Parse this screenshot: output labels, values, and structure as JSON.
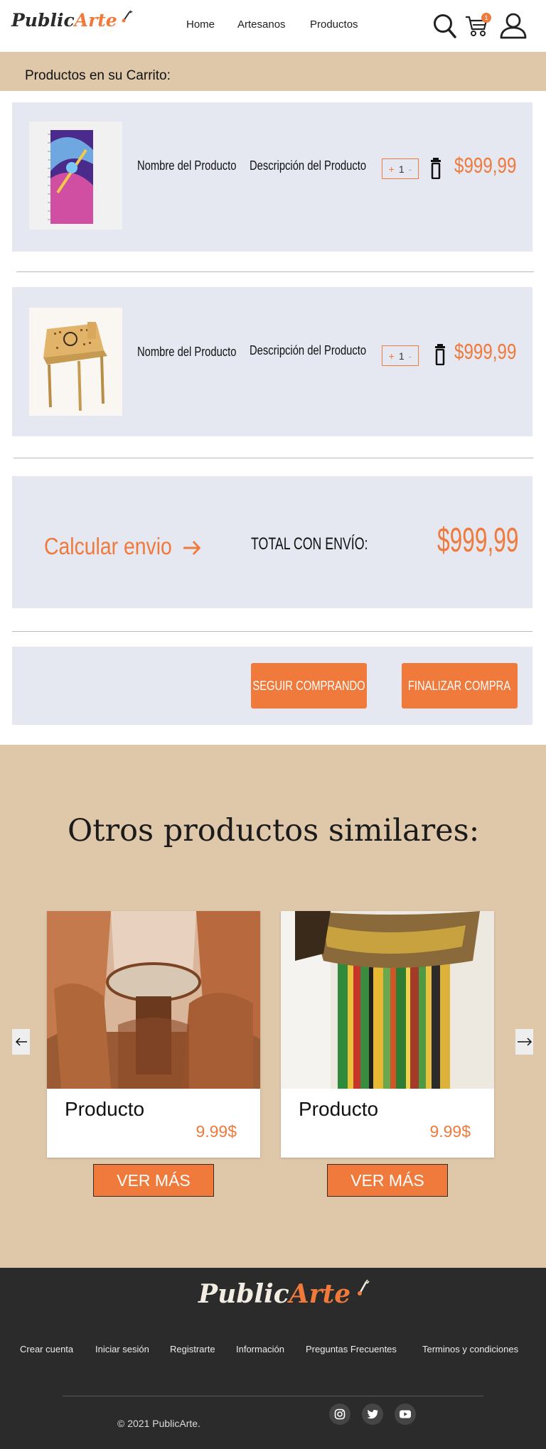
{
  "header": {
    "logo_part1": "Public",
    "logo_part2": "Arte",
    "nav": [
      "Home",
      "Artesanos",
      "Productos"
    ],
    "cart_count": "1"
  },
  "cart": {
    "title": "Productos en su Carrito:",
    "items": [
      {
        "name": "Nombre del Producto",
        "description": "Descripción del Producto",
        "qty_plus": "+",
        "qty": "1",
        "qty_minus": "-",
        "price": "$999,99"
      },
      {
        "name": "Nombre del Producto",
        "description": "Descripción del Producto",
        "qty_plus": "+",
        "qty": "1",
        "qty_minus": "-",
        "price": "$999,99"
      }
    ],
    "shipping_link": "Calcular envio",
    "total_label": "TOTAL CON ENVÍO:",
    "total_price": "$999,99",
    "continue_button": "SEGUIR COMPRANDO",
    "checkout_button": "FINALIZAR COMPRA"
  },
  "similar": {
    "title": "Otros productos similares:",
    "products": [
      {
        "title": "Producto",
        "price": "9.99$",
        "button": "VER MÁS"
      },
      {
        "title": "Producto",
        "price": "9.99$",
        "button": "VER MÁS"
      }
    ]
  },
  "footer": {
    "logo_part1": "Public",
    "logo_part2": "Arte",
    "links": [
      "Crear cuenta",
      "Iniciar sesión",
      "Registrarte",
      "Información",
      "Preguntas Frecuentes",
      "Terminos y condiciones"
    ],
    "copyright": "© 2021 PublicArte.",
    "social": [
      "instagram-icon",
      "twitter-icon",
      "youtube-icon"
    ]
  },
  "colors": {
    "accent": "#ef7a3c",
    "band": "#dfc7aa",
    "panel": "#e5e8f1",
    "footer": "#2b2b2b"
  }
}
